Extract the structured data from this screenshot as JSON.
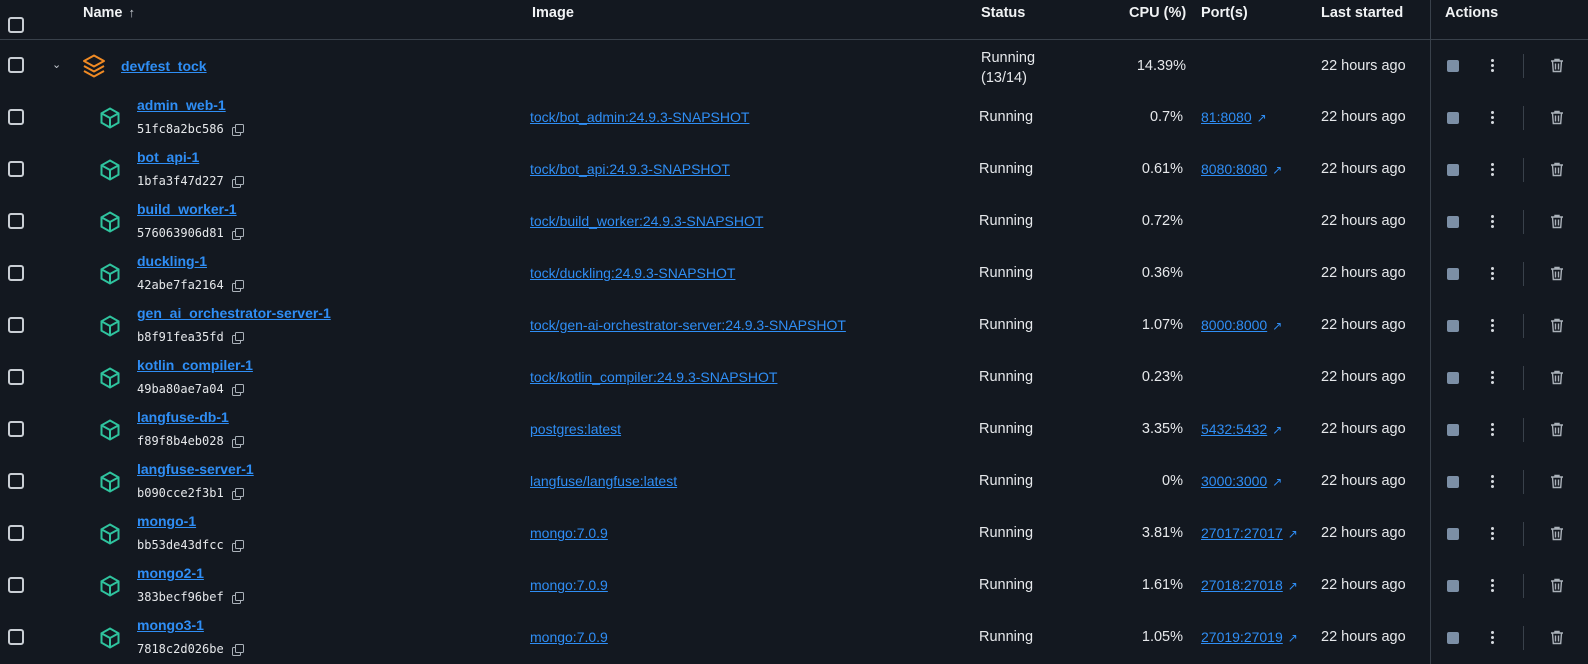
{
  "header": {
    "name": "Name",
    "image": "Image",
    "status": "Status",
    "cpu": "CPU (%)",
    "ports": "Port(s)",
    "last_started": "Last started",
    "actions": "Actions"
  },
  "colors": {
    "link": "#2f8ef5",
    "container_icon": "#2fc39e",
    "stack_icon": "#f08a24",
    "background": "#131820"
  },
  "group": {
    "name": "devfest_tock",
    "status_line1": "Running",
    "status_line2": "(13/14)",
    "cpu": "14.39%",
    "last_started": "22 hours ago",
    "icon": "stack-icon"
  },
  "containers": [
    {
      "name": "admin_web-1",
      "id": "51fc8a2bc586",
      "image": "tock/bot_admin:24.9.3-SNAPSHOT",
      "status": "Running",
      "cpu": "0.7%",
      "port": "81:8080",
      "last_started": "22 hours ago"
    },
    {
      "name": "bot_api-1",
      "id": "1bfa3f47d227",
      "image": "tock/bot_api:24.9.3-SNAPSHOT",
      "status": "Running",
      "cpu": "0.61%",
      "port": "8080:8080",
      "last_started": "22 hours ago"
    },
    {
      "name": "build_worker-1",
      "id": "576063906d81",
      "image": "tock/build_worker:24.9.3-SNAPSHOT",
      "status": "Running",
      "cpu": "0.72%",
      "port": "",
      "last_started": "22 hours ago"
    },
    {
      "name": "duckling-1",
      "id": "42abe7fa2164",
      "image": "tock/duckling:24.9.3-SNAPSHOT",
      "status": "Running",
      "cpu": "0.36%",
      "port": "",
      "last_started": "22 hours ago"
    },
    {
      "name": "gen_ai_orchestrator-server-1",
      "id": "b8f91fea35fd",
      "image": "tock/gen-ai-orchestrator-server:24.9.3-SNAPSHOT",
      "status": "Running",
      "cpu": "1.07%",
      "port": "8000:8000",
      "last_started": "22 hours ago"
    },
    {
      "name": "kotlin_compiler-1",
      "id": "49ba80ae7a04",
      "image": "tock/kotlin_compiler:24.9.3-SNAPSHOT",
      "status": "Running",
      "cpu": "0.23%",
      "port": "",
      "last_started": "22 hours ago"
    },
    {
      "name": "langfuse-db-1",
      "id": "f89f8b4eb028",
      "image": "postgres:latest",
      "status": "Running",
      "cpu": "3.35%",
      "port": "5432:5432",
      "last_started": "22 hours ago"
    },
    {
      "name": "langfuse-server-1",
      "id": "b090cce2f3b1",
      "image": "langfuse/langfuse:latest",
      "status": "Running",
      "cpu": "0%",
      "port": "3000:3000",
      "last_started": "22 hours ago"
    },
    {
      "name": "mongo-1",
      "id": "bb53de43dfcc",
      "image": "mongo:7.0.9",
      "status": "Running",
      "cpu": "3.81%",
      "port": "27017:27017",
      "last_started": "22 hours ago"
    },
    {
      "name": "mongo2-1",
      "id": "383becf96bef",
      "image": "mongo:7.0.9",
      "status": "Running",
      "cpu": "1.61%",
      "port": "27018:27018",
      "last_started": "22 hours ago"
    },
    {
      "name": "mongo3-1",
      "id": "7818c2d026be",
      "image": "mongo:7.0.9",
      "status": "Running",
      "cpu": "1.05%",
      "port": "27019:27019",
      "last_started": "22 hours ago"
    }
  ]
}
